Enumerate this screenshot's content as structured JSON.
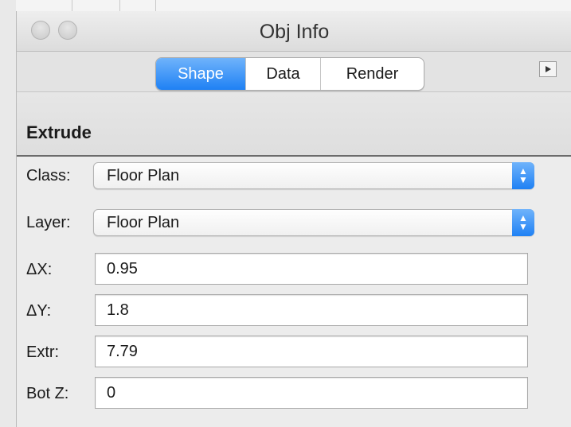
{
  "window": {
    "title": "Obj Info"
  },
  "tabs": [
    {
      "label": "Shape",
      "active": true
    },
    {
      "label": "Data",
      "active": false
    },
    {
      "label": "Render",
      "active": false
    }
  ],
  "section": {
    "label": "Extrude"
  },
  "fields": {
    "class": {
      "label": "Class:",
      "value": "Floor Plan"
    },
    "layer": {
      "label": "Layer:",
      "value": "Floor Plan"
    },
    "dx": {
      "label": "ΔX:",
      "value": "0.95"
    },
    "dy": {
      "label": "ΔY:",
      "value": "1.8"
    },
    "extr": {
      "label": "Extr:",
      "value": "7.79"
    },
    "botz": {
      "label": "Bot Z:",
      "value": "0"
    }
  },
  "colors": {
    "accent": "#1f81f4",
    "panel_bg": "#ececec"
  },
  "icons": {
    "popup_arrows": "up-down-arrows-icon",
    "expand": "right-triangle-icon"
  }
}
